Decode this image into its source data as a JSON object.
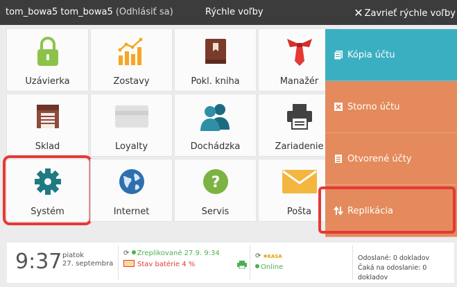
{
  "topbar": {
    "user": "tom_bowa5 tom_bowa5",
    "logout": "(Odhlásiť sa)",
    "title": "Rýchle voľby",
    "close_label": "Zavrieť rýchle voľby"
  },
  "tiles": [
    {
      "label": "Uzávierka",
      "icon": "lock-icon"
    },
    {
      "label": "Zostavy",
      "icon": "bar-chart-icon"
    },
    {
      "label": "Pokl. kniha",
      "icon": "book-icon"
    },
    {
      "label": "Manažér",
      "icon": "tie-icon"
    },
    {
      "label": "Sklad",
      "icon": "warehouse-icon"
    },
    {
      "label": "Loyalty",
      "icon": "card-icon"
    },
    {
      "label": "Dochádzka",
      "icon": "people-icon"
    },
    {
      "label": "Zariadenie",
      "icon": "printer-icon"
    },
    {
      "label": "Systém",
      "icon": "gear-icon"
    },
    {
      "label": "Internet",
      "icon": "globe-icon"
    },
    {
      "label": "Servis",
      "icon": "help-icon"
    },
    {
      "label": "Pošta",
      "icon": "mail-icon"
    }
  ],
  "side": [
    {
      "label": "Kópia účtu",
      "icon": "receipt-copy-icon"
    },
    {
      "label": "Storno účtu",
      "icon": "cancel-receipt-icon"
    },
    {
      "label": "Otvorené účty",
      "icon": "open-receipts-icon"
    },
    {
      "label": "Replikácia",
      "icon": "sync-arrows-icon"
    }
  ],
  "footer": {
    "time": "9:37",
    "weekday": "piatok",
    "date": "27. septembra",
    "sync_status": "Zreplikované 27.9. 9:34",
    "battery": "Stav batérie 4 %",
    "kasa_status": "Online",
    "sent": "Odoslané: 0 dokladov",
    "pending": "Čaká na odoslanie: 0 dokladov"
  },
  "colors": {
    "topbar": "#3c3c3c",
    "side_teal": "#3bafc2",
    "side_orange": "#e48a5c",
    "highlight_red": "#e53935"
  }
}
